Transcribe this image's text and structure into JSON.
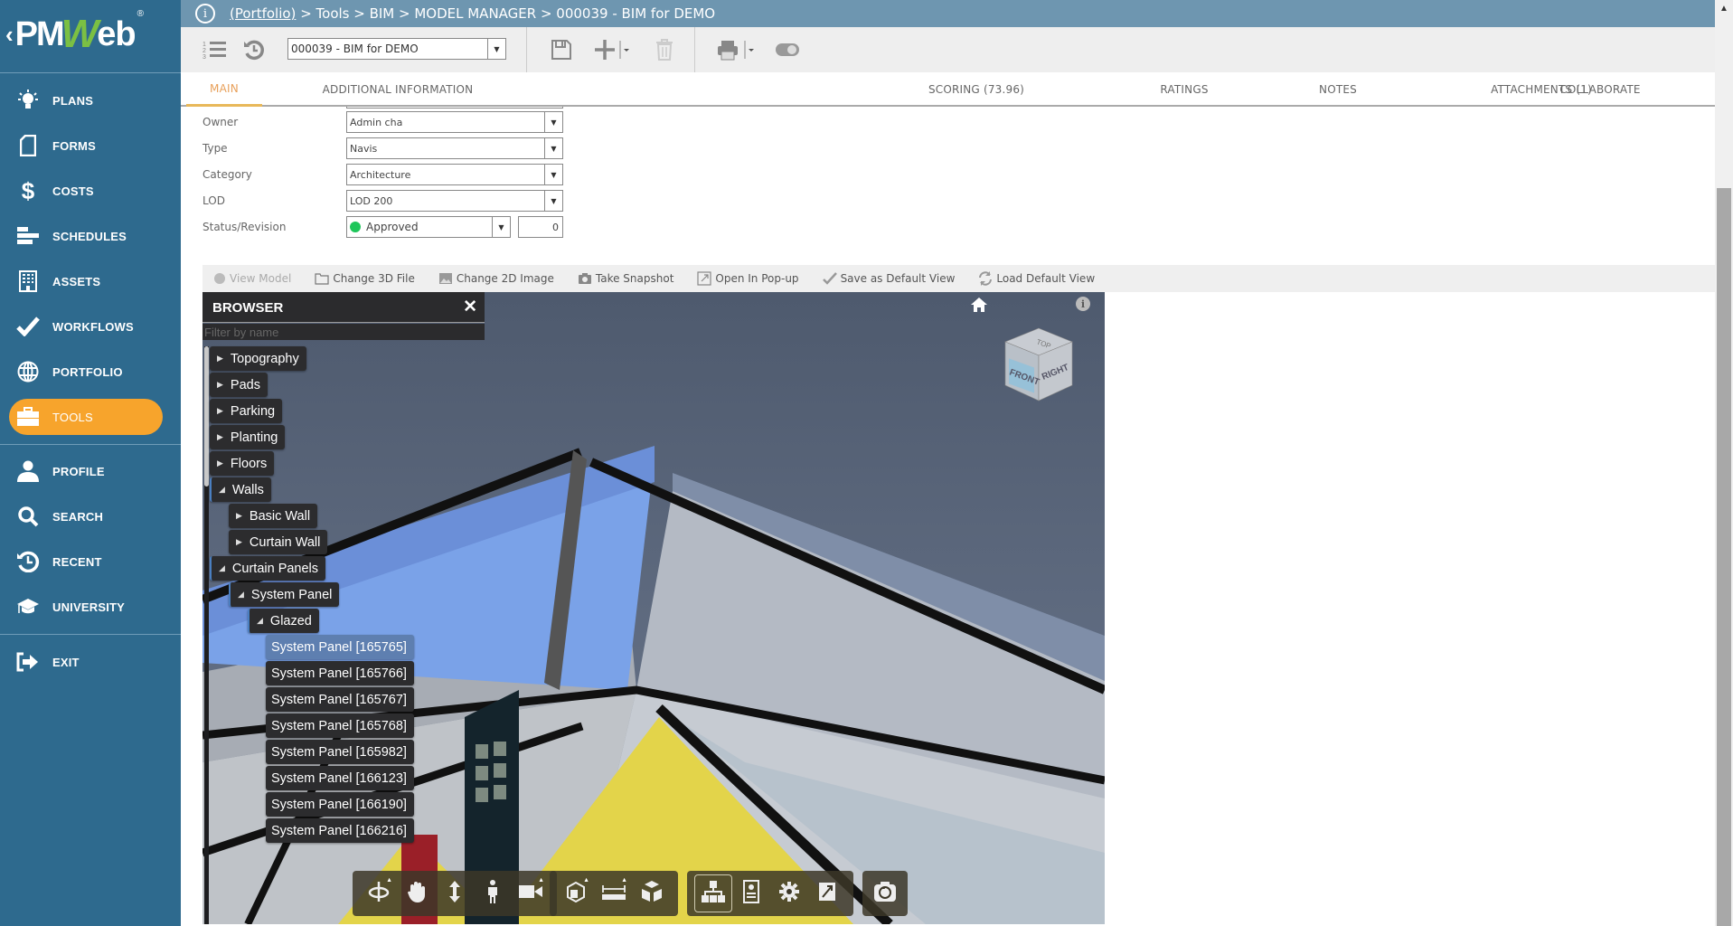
{
  "app": {
    "logo": {
      "chevron": "‹",
      "pm": "PM",
      "w": "W",
      "eb": "eb",
      "reg": "®",
      "accent": "#7bc043"
    }
  },
  "sidebar": {
    "background": "#2e6a8e",
    "active_color": "#f7a42c",
    "items": [
      {
        "label": "PLANS",
        "icon": "lightbulb-icon"
      },
      {
        "label": "FORMS",
        "icon": "document-icon"
      },
      {
        "label": "COSTS",
        "icon": "dollar-icon"
      },
      {
        "label": "SCHEDULES",
        "icon": "gantt-icon"
      },
      {
        "label": "ASSETS",
        "icon": "building-icon"
      },
      {
        "label": "WORKFLOWS",
        "icon": "checkmark-icon"
      },
      {
        "label": "PORTFOLIO",
        "icon": "globe-icon"
      },
      {
        "label": "TOOLS",
        "icon": "toolbox-icon",
        "active": true
      },
      {
        "label": "PROFILE",
        "icon": "user-icon"
      },
      {
        "label": "SEARCH",
        "icon": "search-icon"
      },
      {
        "label": "RECENT",
        "icon": "history-icon"
      },
      {
        "label": "UNIVERSITY",
        "icon": "graduation-cap-icon"
      },
      {
        "label": "EXIT",
        "icon": "exit-icon"
      }
    ]
  },
  "breadcrumb": {
    "link": "(Portfolio)",
    "rest": " > Tools > BIM > MODEL MANAGER > 000039 - BIM for DEMO"
  },
  "toolbar": {
    "record_select": "000039 - BIM for DEMO",
    "icons": [
      "numbered-list-icon",
      "history-icon",
      "save-icon",
      "add-icon",
      "delete-icon",
      "print-icon",
      "toggle-icon"
    ]
  },
  "tabs": [
    {
      "label": "MAIN",
      "active": true
    },
    {
      "label": "ADDITIONAL INFORMATION"
    },
    {
      "label": "SCORING (73.96)"
    },
    {
      "label": "RATINGS"
    },
    {
      "label": "NOTES"
    },
    {
      "label": "ATTACHMENTS (1)"
    },
    {
      "label": "COLLABORATE"
    }
  ],
  "form": {
    "owner": {
      "label": "Owner",
      "value": "Admin cha"
    },
    "type": {
      "label": "Type",
      "value": "Navis"
    },
    "category": {
      "label": "Category",
      "value": "Architecture"
    },
    "lod": {
      "label": "LOD",
      "value": "LOD 200"
    },
    "status": {
      "label": "Status/Revision",
      "value": "Approved",
      "status_color": "#1ec65a",
      "revision": "0"
    }
  },
  "viewer_actions": [
    {
      "label": "View Model",
      "icon": "view-model-icon",
      "disabled": true
    },
    {
      "label": "Change 3D File",
      "icon": "folder-icon"
    },
    {
      "label": "Change 2D Image",
      "icon": "image-icon"
    },
    {
      "label": "Take Snapshot",
      "icon": "camera-icon"
    },
    {
      "label": "Open In Pop-up",
      "icon": "popup-icon"
    },
    {
      "label": "Save as Default View",
      "icon": "checkmark-icon"
    },
    {
      "label": "Load Default View",
      "icon": "refresh-icon"
    }
  ],
  "browser": {
    "title": "BROWSER",
    "close": "✕",
    "filter_placeholder": "Filter by name",
    "nodes": [
      {
        "label": "Topography",
        "level": 0,
        "state": "collapsed"
      },
      {
        "label": "Pads",
        "level": 0,
        "state": "collapsed"
      },
      {
        "label": "Parking",
        "level": 0,
        "state": "collapsed"
      },
      {
        "label": "Planting",
        "level": 0,
        "state": "collapsed"
      },
      {
        "label": "Floors",
        "level": 0,
        "state": "collapsed"
      },
      {
        "label": "Walls",
        "level": 0,
        "state": "expanded"
      },
      {
        "label": "Basic Wall",
        "level": 1,
        "state": "collapsed"
      },
      {
        "label": "Curtain Wall",
        "level": 1,
        "state": "collapsed"
      },
      {
        "label": "Curtain Panels",
        "level": 0,
        "state": "expanded"
      },
      {
        "label": "System Panel",
        "level": 1,
        "state": "expanded"
      },
      {
        "label": "Glazed",
        "level": 2,
        "state": "expanded"
      },
      {
        "label": "System Panel [165765]",
        "level": 3,
        "state": "leaf",
        "selected": true
      },
      {
        "label": "System Panel [165766]",
        "level": 3,
        "state": "leaf"
      },
      {
        "label": "System Panel [165767]",
        "level": 3,
        "state": "leaf"
      },
      {
        "label": "System Panel [165768]",
        "level": 3,
        "state": "leaf"
      },
      {
        "label": "System Panel [165982]",
        "level": 3,
        "state": "leaf"
      },
      {
        "label": "System Panel [166123]",
        "level": 3,
        "state": "leaf"
      },
      {
        "label": "System Panel [166190]",
        "level": 3,
        "state": "leaf"
      },
      {
        "label": "System Panel [166216]",
        "level": 3,
        "state": "leaf"
      }
    ]
  },
  "viewcube": {
    "top": "TOP",
    "front": "FRONT",
    "right": "RIGHT"
  },
  "viewer_tools": [
    [
      {
        "name": "orbit-tool",
        "icon": "orbit-icon",
        "menu": true
      },
      {
        "name": "pan-tool",
        "icon": "hand-icon"
      },
      {
        "name": "zoom-tool",
        "icon": "vertical-arrows-icon"
      },
      {
        "name": "first-person-tool",
        "icon": "person-icon"
      },
      {
        "name": "camera-tool",
        "icon": "video-camera-icon",
        "menu": true
      },
      {
        "name": "section-tool",
        "icon": "section-box-icon",
        "menu": true
      },
      {
        "name": "measure-tool",
        "icon": "ruler-icon",
        "menu": true
      },
      {
        "name": "explode-tool",
        "icon": "explode-cube-icon"
      }
    ],
    [
      {
        "name": "model-browser-tool",
        "icon": "hierarchy-icon",
        "active": true
      },
      {
        "name": "properties-tool",
        "icon": "properties-icon"
      },
      {
        "name": "settings-tool",
        "icon": "gear-icon"
      },
      {
        "name": "fullscreen-tool",
        "icon": "fullscreen-icon"
      }
    ],
    [
      {
        "name": "snapshot-tool",
        "icon": "camera-rotate-icon"
      }
    ]
  ]
}
